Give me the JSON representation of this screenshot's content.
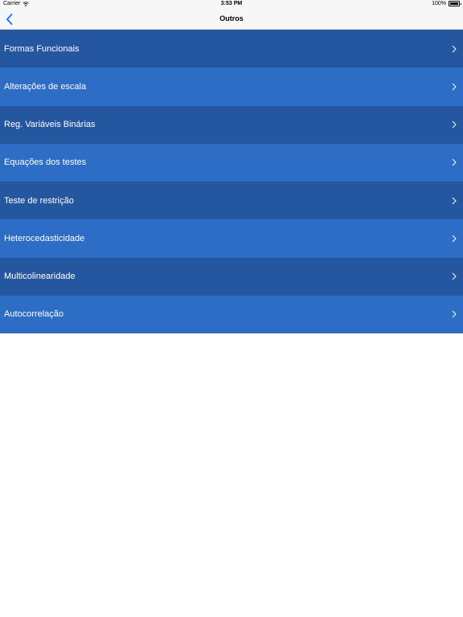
{
  "status_bar": {
    "carrier": "Carrier",
    "time": "3:53 PM",
    "battery": "100%"
  },
  "nav": {
    "title": "Outros",
    "back_icon": "chevron-left-icon"
  },
  "colors": {
    "row_dark": "#2557a0",
    "row_light": "#2d6dc5",
    "accent": "#1a7cf5"
  },
  "menu": {
    "items": [
      {
        "label": "Formas Funcionais"
      },
      {
        "label": "Alterações de escala"
      },
      {
        "label": "Reg. Variáveis Binárias"
      },
      {
        "label": "Equações dos testes"
      },
      {
        "label": "Teste de restrição"
      },
      {
        "label": "Heterocedasticidade"
      },
      {
        "label": "Multicolinearidade"
      },
      {
        "label": "Autocorrelação"
      }
    ]
  }
}
